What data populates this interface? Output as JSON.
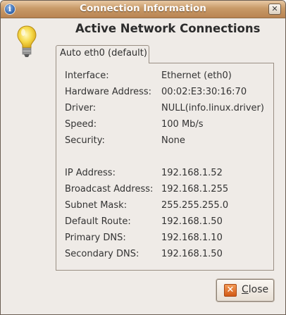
{
  "window": {
    "title": "Connection Information",
    "info_icon_glyph": "i",
    "close_glyph": "✕"
  },
  "heading": "Active Network Connections",
  "tab": {
    "label": "Auto eth0 (default)"
  },
  "details": [
    {
      "label": "Interface:",
      "value": "Ethernet (eth0)"
    },
    {
      "label": "Hardware Address:",
      "value": "00:02:E3:30:16:70"
    },
    {
      "label": "Driver:",
      "value": "NULL(info.linux.driver)"
    },
    {
      "label": "Speed:",
      "value": "100 Mb/s"
    },
    {
      "label": "Security:",
      "value": "None"
    },
    {
      "label": "IP Address:",
      "value": "192.168.1.52"
    },
    {
      "label": "Broadcast Address:",
      "value": "192.168.1.255"
    },
    {
      "label": "Subnet Mask:",
      "value": "255.255.255.0"
    },
    {
      "label": "Default Route:",
      "value": "192.168.1.50"
    },
    {
      "label": "Primary DNS:",
      "value": "192.168.1.10"
    },
    {
      "label": "Secondary DNS:",
      "value": "192.168.1.50"
    }
  ],
  "close_button": {
    "mnemonic": "C",
    "label_rest": "lose",
    "icon_glyph": "✕"
  },
  "colors": {
    "titlebar": "#c89a68",
    "window_bg": "#efebe7",
    "close_icon": "#e06a24"
  },
  "icons": [
    "info-icon",
    "close-icon",
    "lightbulb-icon",
    "close-x-icon"
  ]
}
